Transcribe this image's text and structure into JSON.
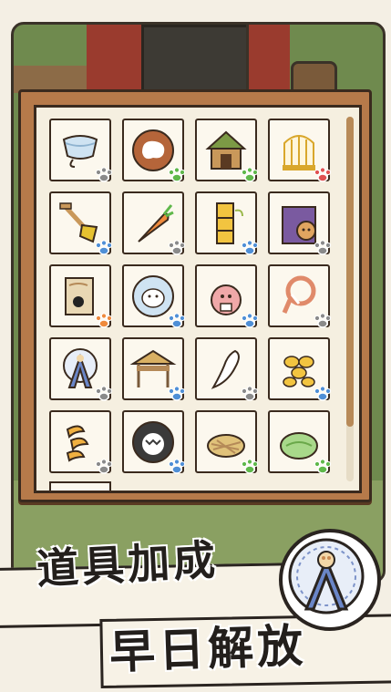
{
  "headline": {
    "line1": "道具加成",
    "line2": "早日解放"
  },
  "colors": {
    "frame": "#b67a4a",
    "panel": "#f5efe0",
    "paw_orange": "#ef8a3c",
    "paw_blue": "#4f8fd6",
    "paw_green": "#5fb84a",
    "paw_red": "#e05050",
    "paw_gray": "#8a8a8a"
  },
  "items": [
    {
      "name": "bowl",
      "icon": "bowl-icon",
      "paw": "gray"
    },
    {
      "name": "plate",
      "icon": "plate-icon",
      "paw": "green"
    },
    {
      "name": "house",
      "icon": "house-icon",
      "paw": "green"
    },
    {
      "name": "cage",
      "icon": "cage-icon",
      "paw": "red"
    },
    {
      "name": "shovel",
      "icon": "shovel-icon",
      "paw": "blue"
    },
    {
      "name": "carrot",
      "icon": "carrot-icon",
      "paw": "gray"
    },
    {
      "name": "tunnel",
      "icon": "tunnel-icon",
      "paw": "blue"
    },
    {
      "name": "bag",
      "icon": "bag-icon",
      "paw": "gray"
    },
    {
      "name": "map",
      "icon": "map-icon",
      "paw": "orange"
    },
    {
      "name": "sheep-plate",
      "icon": "sheep-plate-icon",
      "paw": "blue"
    },
    {
      "name": "piggy-bank",
      "icon": "piggy-bank-icon",
      "paw": "blue"
    },
    {
      "name": "rope",
      "icon": "rope-icon",
      "paw": "gray"
    },
    {
      "name": "wheel",
      "icon": "hamster-wheel-icon",
      "paw": "gray"
    },
    {
      "name": "hut",
      "icon": "straw-hut-icon",
      "paw": "blue"
    },
    {
      "name": "bone",
      "icon": "bone-icon",
      "paw": "gray"
    },
    {
      "name": "seeds",
      "icon": "seeds-icon",
      "paw": "blue"
    },
    {
      "name": "snack",
      "icon": "snack-icon",
      "paw": "gray"
    },
    {
      "name": "monster-plate",
      "icon": "monster-plate-icon",
      "paw": "blue"
    },
    {
      "name": "hay-nest",
      "icon": "hay-nest-icon",
      "paw": "green"
    },
    {
      "name": "grass-bed",
      "icon": "grass-bed-icon",
      "paw": "green"
    }
  ]
}
